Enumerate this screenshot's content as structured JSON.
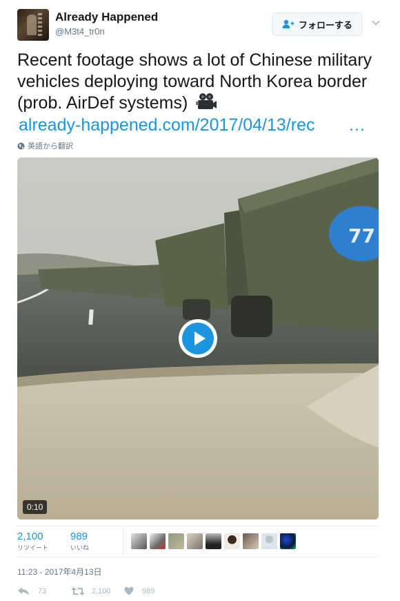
{
  "user": {
    "display_name": "Already Happened",
    "handle": "@M3t4_tr0n",
    "follow_label": "フォローする"
  },
  "tweet": {
    "text": "Recent footage shows a lot of Chinese military vehicles deploying toward North Korea border (prob. AirDef systems)",
    "camera_emoji": "video-camera-icon",
    "link_text": "already-happened.com/2017/04/13/rec",
    "link_ellipsis": "…",
    "translate_label": "英語から翻訳"
  },
  "media": {
    "duration": "0:10"
  },
  "stats": {
    "retweets_count": "2,100",
    "retweets_label": "リツイート",
    "likes_count": "989",
    "likes_label": "いいね"
  },
  "timestamp": "11:23 - 2017年4月13日",
  "actions": {
    "reply_count": "73",
    "retweet_count": "2,100",
    "like_count": "989"
  },
  "colors": {
    "accent": "#1b95e0",
    "muted": "#657786",
    "icon": "#aab8c2"
  }
}
